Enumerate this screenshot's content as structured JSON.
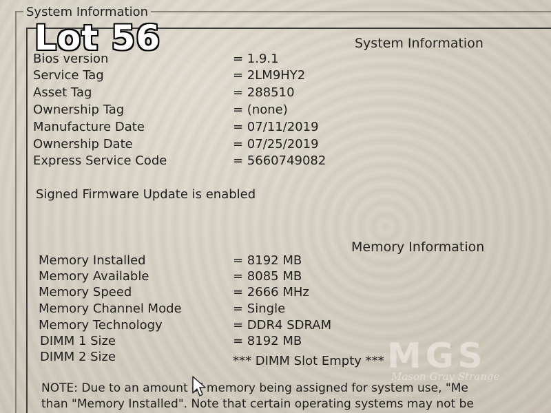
{
  "overlay": {
    "lot_label": "Lot 56"
  },
  "group_box": {
    "title": "System Information"
  },
  "system_section": {
    "heading": "System Information",
    "rows": [
      {
        "label": "Bios version",
        "value": "= 1.9.1"
      },
      {
        "label": "Service Tag",
        "value": "= 2LM9HY2"
      },
      {
        "label": "Asset Tag",
        "value": "= 288510"
      },
      {
        "label": "Ownership Tag",
        "value": "= (none)"
      },
      {
        "label": "Manufacture Date",
        "value": "= 07/11/2019"
      },
      {
        "label": "Ownership Date",
        "value": "= 07/25/2019"
      },
      {
        "label": "Express Service Code",
        "value": "= 5660749082"
      }
    ],
    "firmware_status": "Signed Firmware Update is enabled"
  },
  "memory_section": {
    "heading": "Memory Information",
    "rows": [
      {
        "label": "Memory Installed",
        "value": "= 8192 MB"
      },
      {
        "label": "Memory Available",
        "value": "= 8085 MB"
      },
      {
        "label": "Memory Speed",
        "value": "= 2666 MHz"
      },
      {
        "label": "Memory Channel Mode",
        "value": "= Single"
      },
      {
        "label": "Memory Technology",
        "value": "= DDR4 SDRAM"
      },
      {
        "label": "DIMM 1 Size",
        "value": "= 8192 MB"
      },
      {
        "label": "DIMM 2 Size",
        "value": "*** DIMM Slot Empty ***"
      }
    ]
  },
  "note": {
    "line1": "NOTE: Due to an amount of memory being assigned for system use, \"Me",
    "line2": "than \"Memory Installed\". Note that certain operating systems may not be"
  },
  "watermark": {
    "letters": "MGS",
    "tagline": "Mason Gray Strange"
  },
  "icons": {
    "cursor": "mouse-pointer-icon"
  }
}
